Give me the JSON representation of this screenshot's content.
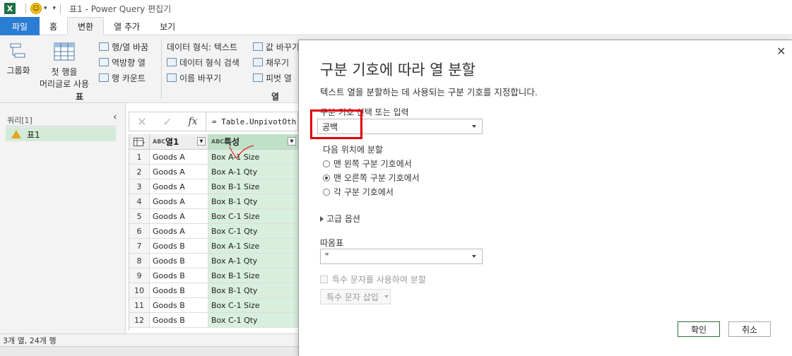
{
  "titlebar": {
    "logo": "X",
    "smiley": "☺",
    "dropdown": "▾",
    "title": "표1 - Power Query 편집기"
  },
  "tabs": [
    {
      "label": "파일"
    },
    {
      "label": "홈"
    },
    {
      "label": "변환"
    },
    {
      "label": "열 추가"
    },
    {
      "label": "보기"
    }
  ],
  "ribbon": {
    "group_btn": "그룹화",
    "first_row_1": "첫 행을",
    "first_row_2": "머리글로 사용",
    "transpose_row_col": "행/열 바꿈",
    "reverse_rows": "역방향 열",
    "count_rows": "행 카운트",
    "table_group_label": "표",
    "data_type": "데이터 형식: 텍스트",
    "detect_type": "데이터 형식 검색",
    "rename": "이름 바꾸기",
    "replace_values": "값 바꾸기",
    "fill": "채우기",
    "pivot": "피벗 열",
    "column_group_label": "열"
  },
  "queries": {
    "title": "쿼리[1]",
    "collapse": "‹",
    "items": [
      {
        "label": "표1"
      }
    ]
  },
  "formula": {
    "cancel": "✕",
    "confirm": "✓",
    "fx": "fx",
    "text": "= Table.UnpivotOth"
  },
  "grid": {
    "columns": [
      {
        "type": "ABC",
        "name": "열1"
      },
      {
        "type": "ABC",
        "name": "특성"
      }
    ],
    "rows": [
      {
        "n": "1",
        "a": "Goods A",
        "b": "Box A-1 Size"
      },
      {
        "n": "2",
        "a": "Goods A",
        "b": "Box A-1 Qty"
      },
      {
        "n": "3",
        "a": "Goods A",
        "b": "Box B-1 Size"
      },
      {
        "n": "4",
        "a": "Goods A",
        "b": "Box B-1 Qty"
      },
      {
        "n": "5",
        "a": "Goods A",
        "b": "Box C-1 Size"
      },
      {
        "n": "6",
        "a": "Goods A",
        "b": "Box C-1 Qty"
      },
      {
        "n": "7",
        "a": "Goods B",
        "b": "Box A-1 Size"
      },
      {
        "n": "8",
        "a": "Goods B",
        "b": "Box A-1 Qty"
      },
      {
        "n": "9",
        "a": "Goods B",
        "b": "Box B-1 Size"
      },
      {
        "n": "10",
        "a": "Goods B",
        "b": "Box B-1 Qty"
      },
      {
        "n": "11",
        "a": "Goods B",
        "b": "Box C-1 Size"
      },
      {
        "n": "12",
        "a": "Goods B",
        "b": "Box C-1 Qty"
      }
    ]
  },
  "status": {
    "text": "3개 열, 24개 행"
  },
  "dialog": {
    "close": "✕",
    "title": "구분 기호에 따라 열 분할",
    "description": "텍스트 열을 분할하는 데 사용되는 구분 기호를 지정합니다.",
    "delimiter_label": "구분 기호 선택 또는 입력",
    "delimiter_value": "공백",
    "split_at_label": "다음 위치에 분할",
    "options": [
      {
        "label": "맨 왼쪽 구분 기호에서",
        "selected": false
      },
      {
        "label": "맨 오른쪽 구분 기호에서",
        "selected": true
      },
      {
        "label": "각 구분 기호에서",
        "selected": false
      }
    ],
    "advanced": "고급 옵션",
    "quote_label": "따옴표",
    "quote_value": "\"",
    "special_chars": "특수 문자를 사용하여 분할",
    "insert_special": "특수 문자 삽입",
    "ok": "확인",
    "cancel": "취소"
  },
  "colors": {
    "file_tab": "#2b7cd3",
    "selected_column": "#d8efdd",
    "ok_border": "#2d6e3c",
    "highlight": "#e00000"
  }
}
